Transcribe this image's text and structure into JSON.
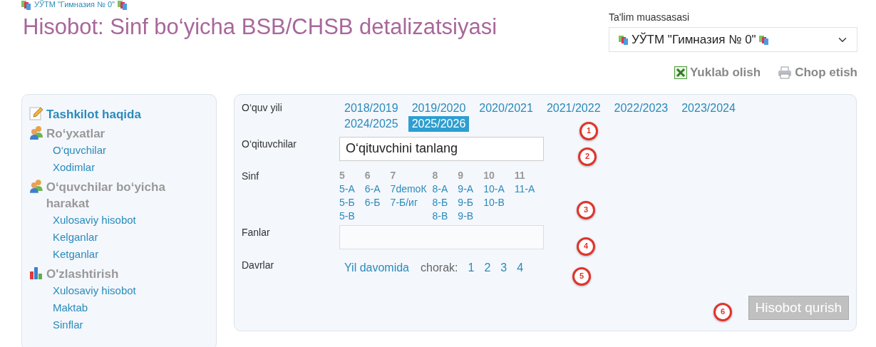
{
  "breadcrumb": "УЎТМ \"Гимназия № 0\"",
  "title": "Hisobot: Sinf bo‘yicha BSB/CHSB detalizatsiyasi",
  "institution": {
    "label": "Ta'lim muassasasi",
    "value": "УЎТМ \"Гимназия № 0\""
  },
  "actions": [
    {
      "kind": "excel",
      "label": "Yuklab olish"
    },
    {
      "kind": "print",
      "label": "Chop etish"
    }
  ],
  "sidebar": {
    "sections": [
      {
        "kind": "link",
        "title": "Tashkilot haqida"
      },
      {
        "kind": "group",
        "title": "Ro‘yxatlar",
        "items": [
          "O‘quvchilar",
          "Xodimlar"
        ]
      },
      {
        "kind": "group",
        "title": "O‘quvchilar bo‘yicha harakat",
        "items": [
          "Xulosaviy hisobot",
          "Kelganlar",
          "Ketganlar"
        ]
      },
      {
        "kind": "group",
        "title": "O'zlashtirish",
        "items": [
          "Xulosaviy hisobot",
          "Maktab",
          "Sinflar"
        ]
      }
    ]
  },
  "form": {
    "years": {
      "label": "O‘quv yili",
      "options": [
        {
          "label": "2018/2019",
          "selected": false
        },
        {
          "label": "2019/2020",
          "selected": false
        },
        {
          "label": "2020/2021",
          "selected": false
        },
        {
          "label": "2021/2022",
          "selected": false
        },
        {
          "label": "2022/2023",
          "selected": false
        },
        {
          "label": "2023/2024",
          "selected": false
        },
        {
          "label": "2024/2025",
          "selected": false
        },
        {
          "label": "2025/2026",
          "selected": true
        }
      ]
    },
    "teachers": {
      "label": "O‘qituvchilar",
      "value": "O‘qituvchini tanlang"
    },
    "classes": {
      "label": "Sinf",
      "grades": [
        {
          "grade": "5",
          "classes": [
            "5-А",
            "5-Б",
            "5-В"
          ]
        },
        {
          "grade": "6",
          "classes": [
            "6-А",
            "6-Б"
          ]
        },
        {
          "grade": "7",
          "classes": [
            "7demoК",
            "7-Б/иг"
          ]
        },
        {
          "grade": "8",
          "classes": [
            "8-А",
            "8-Б",
            "8-В"
          ]
        },
        {
          "grade": "9",
          "classes": [
            "9-А",
            "9-Б",
            "9-В"
          ]
        },
        {
          "grade": "10",
          "classes": [
            "10-А",
            "10-В"
          ]
        },
        {
          "grade": "11",
          "classes": [
            "11-А"
          ]
        }
      ]
    },
    "subjects": {
      "label": "Fanlar"
    },
    "periods": {
      "label": "Davrlar",
      "whole_year": "Yil davomida",
      "quarter_label": "chorak:",
      "quarters": [
        "1",
        "2",
        "3",
        "4"
      ]
    },
    "submit": {
      "label": "Hisobot qurish",
      "disabled": true
    }
  },
  "markers": [
    "1",
    "2",
    "3",
    "4",
    "5",
    "6"
  ]
}
